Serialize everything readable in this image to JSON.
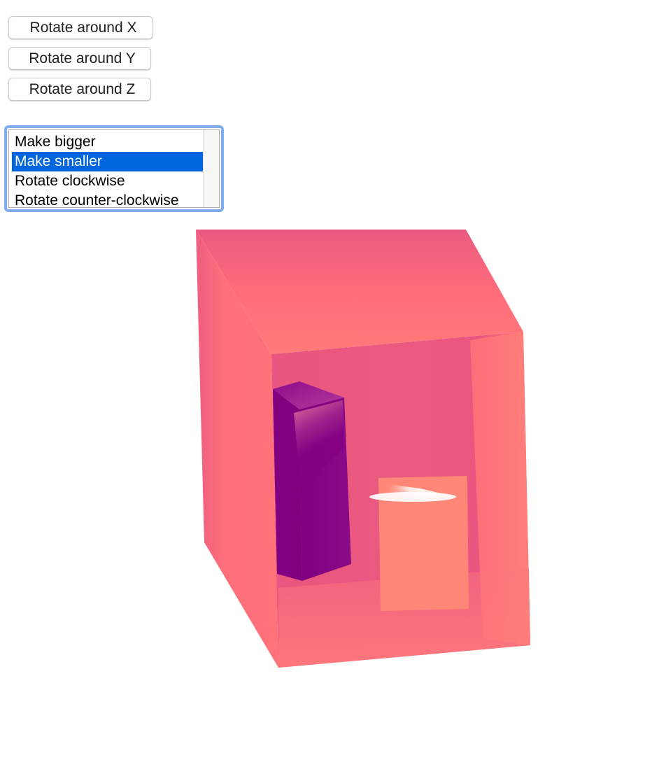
{
  "controls": {
    "rotate_x_label": "Rotate around X",
    "rotate_y_label": "Rotate around Y",
    "rotate_z_label": "Rotate around Z"
  },
  "actions_list": {
    "options": [
      {
        "label": "Make bigger",
        "selected": false
      },
      {
        "label": "Make smaller",
        "selected": true
      },
      {
        "label": "Rotate clockwise",
        "selected": false
      },
      {
        "label": "Rotate counter-clockwise",
        "selected": false
      }
    ]
  },
  "scene": {
    "objects": [
      "open-box",
      "purple-prism",
      "salmon-panel"
    ],
    "colors": {
      "box_pink": "#ff6f7a",
      "box_inner": "#e8577f",
      "prism_purple": "#800080",
      "panel_salmon": "#ff8778",
      "highlight": "#ffffff",
      "selection_blue": "#0066dd",
      "focus_ring": "#7fadf0"
    }
  }
}
